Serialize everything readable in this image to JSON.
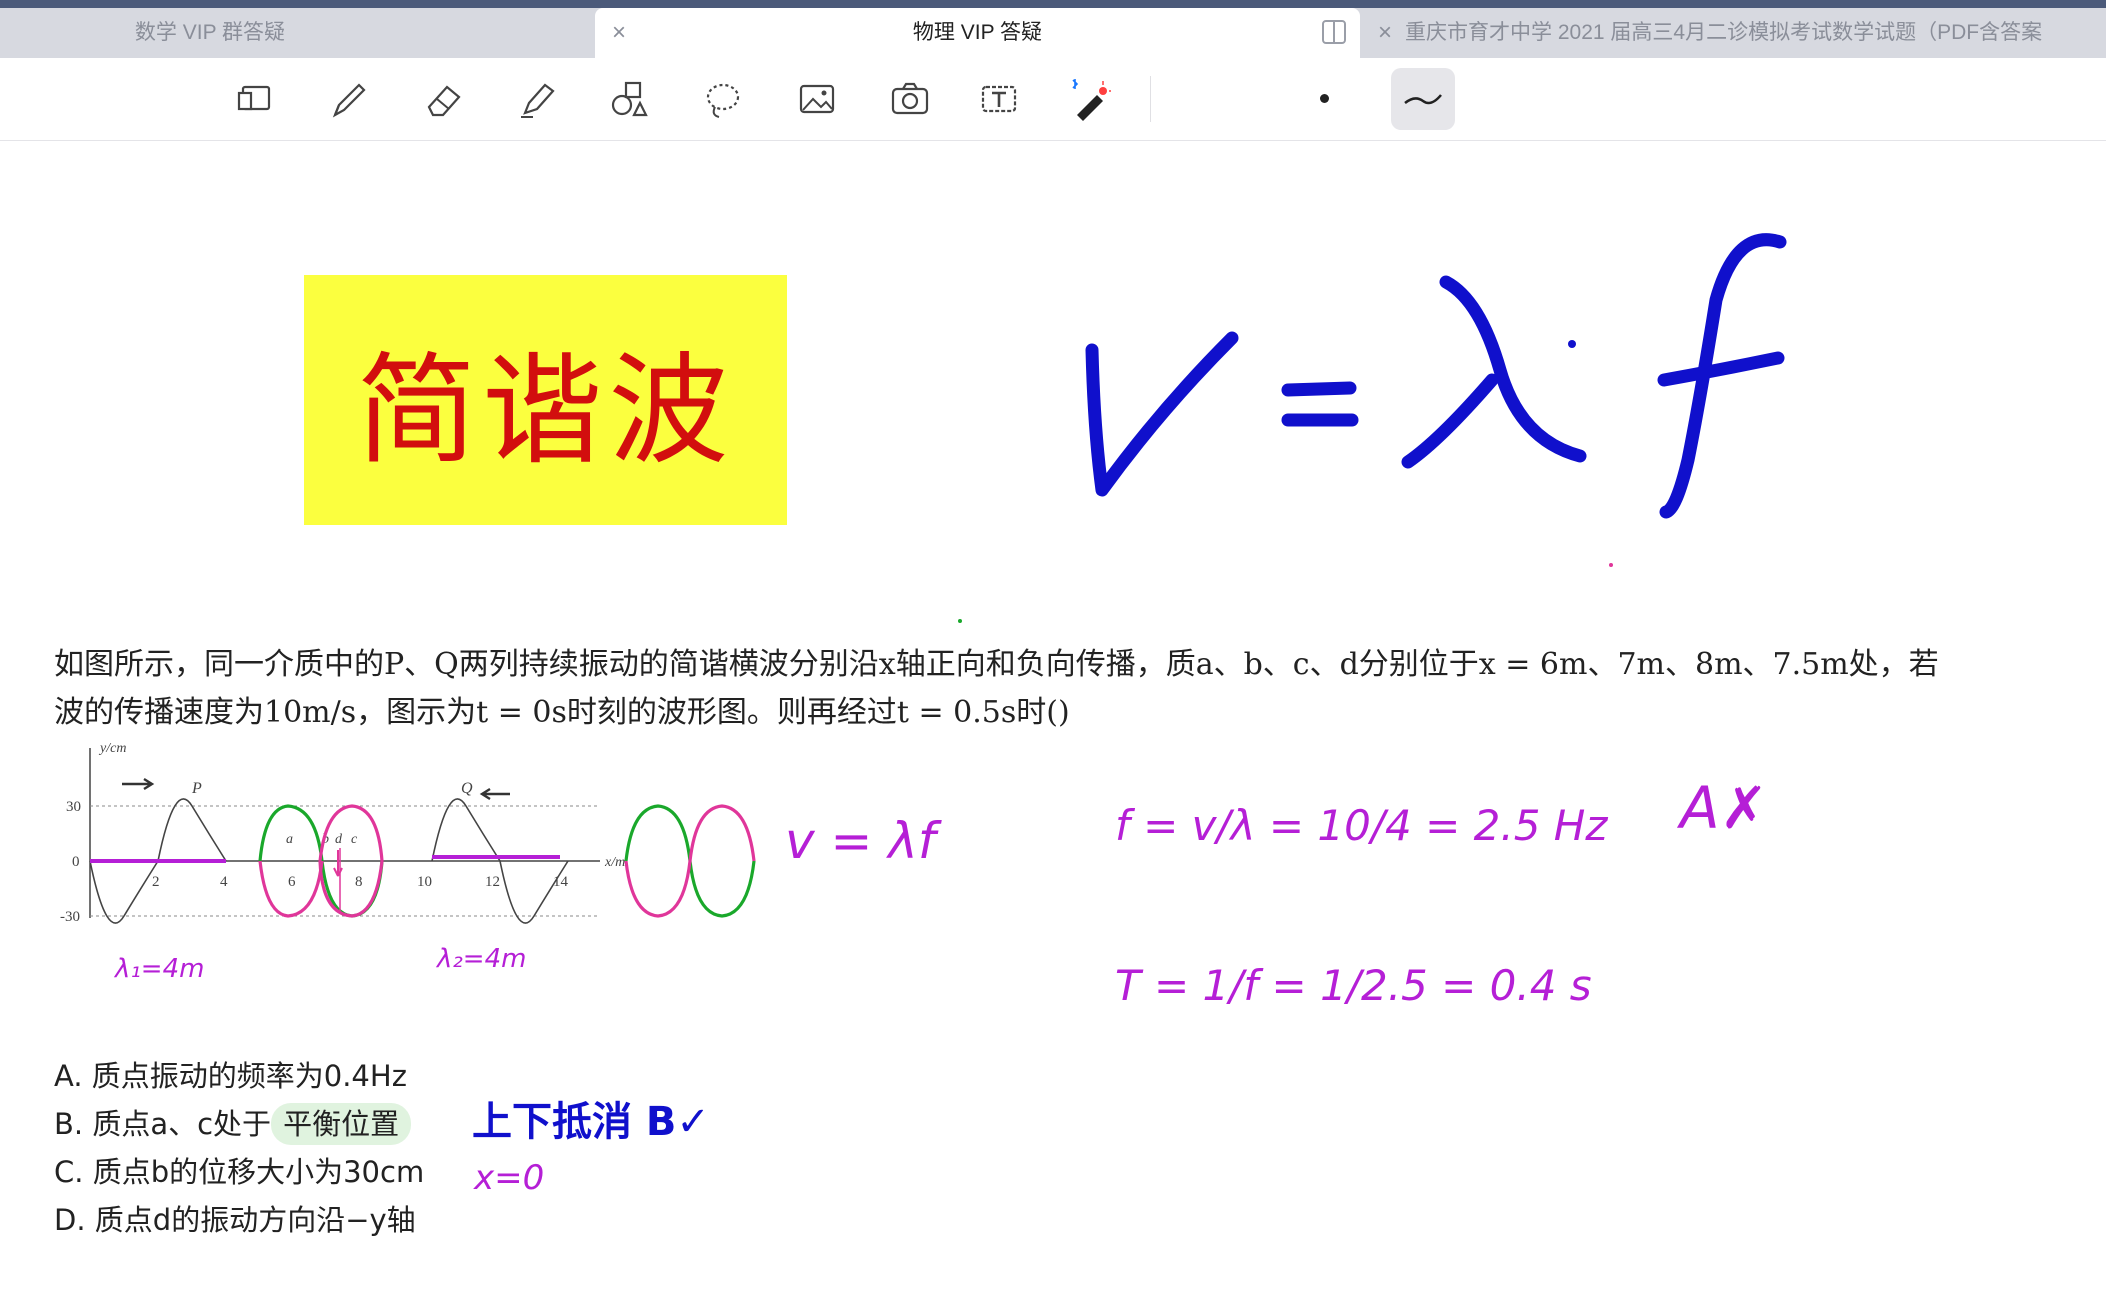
{
  "tabs": [
    {
      "label": "数学 VIP 群答疑"
    },
    {
      "label": "物理 VIP 答疑"
    },
    {
      "label": "重庆市育才中学 2021 届高三4月二诊模拟考试数学试题（PDF含答案"
    }
  ],
  "toolbar": {
    "tools": [
      "page-icon",
      "pen-icon",
      "eraser-icon",
      "highlighter-icon",
      "shapes-icon",
      "lasso-icon",
      "image-icon",
      "camera-icon",
      "textbox-icon",
      "laser-pointer-icon"
    ]
  },
  "title_label": "简谐波",
  "question": {
    "line1": "如图所示，同一介质中的P、Q两列持续振动的简谐横波分别沿x轴正向和负向传播，质a、b、c、d分别位于x = 6m、7m、8m、7.5m处，若",
    "line2": "波的传播速度为10m/s，图示为t = 0s时刻的波形图。则再经过t = 0.5s时()"
  },
  "figure": {
    "y_label": "y/cm",
    "x_label": "x/m",
    "y_ticks": [
      "30",
      "0",
      "-30"
    ],
    "x_ticks": [
      "2",
      "4",
      "6",
      "8",
      "10",
      "12",
      "14"
    ],
    "wave_labels": [
      "P",
      "Q"
    ],
    "point_labels": [
      "a",
      "b",
      "d",
      "c"
    ],
    "lambda1": "λ₁=4m",
    "lambda2": "λ₂=4m"
  },
  "options": [
    {
      "letter": "A.",
      "text": "质点振动的频率为0.4Hz"
    },
    {
      "letter": "B.",
      "text_pre": "质点a、c处于",
      "text_hl": "平衡位置"
    },
    {
      "letter": "C.",
      "text": "质点b的位移大小为30cm"
    },
    {
      "letter": "D.",
      "text": "质点d的振动方向沿−y轴"
    }
  ],
  "annotations": {
    "b_note": "上下抵消 B✓",
    "c_note": "x=0",
    "formula1": "v = λf",
    "formula2": "f = v/λ = 10/4 = 2.5 Hz",
    "formula3": "T = 1/f = 1/2.5 = 0.4 s",
    "a_note": "A✗"
  },
  "colors": {
    "title_bg": "#fbff3f",
    "title_text": "#d20e0e",
    "ink_blue": "#1010cc",
    "ink_purple": "#b51fd6",
    "ink_pink": "#e0369a",
    "ink_green": "#1aa82b",
    "highlight": "#e0f3df"
  }
}
